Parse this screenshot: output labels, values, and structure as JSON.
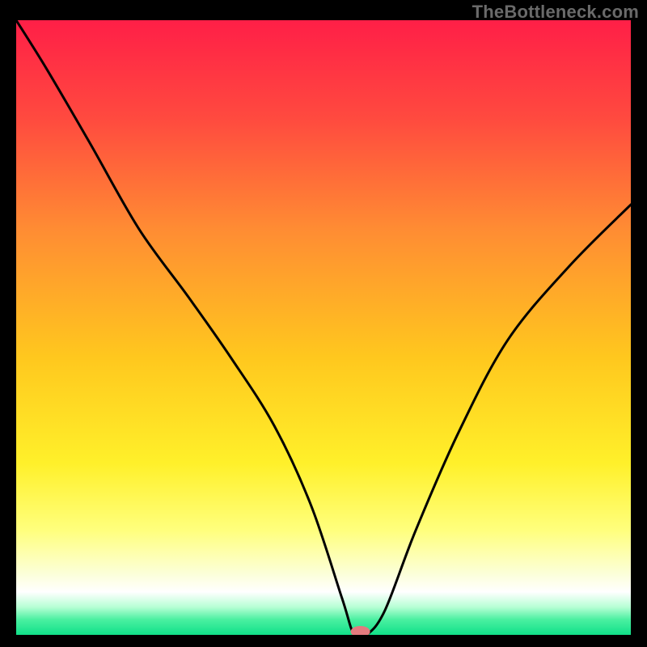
{
  "watermark": "TheBottleneck.com",
  "chart_data": {
    "type": "line",
    "title": "",
    "xlabel": "",
    "ylabel": "",
    "xlim": [
      0,
      100
    ],
    "ylim": [
      0,
      100
    ],
    "x": [
      0,
      5,
      12,
      20,
      28,
      35,
      42,
      48,
      53,
      55,
      57,
      60,
      65,
      72,
      80,
      90,
      100
    ],
    "values": [
      100,
      92,
      80,
      66,
      55,
      45,
      34,
      21,
      6,
      0,
      0,
      4,
      17,
      33,
      48,
      60,
      70
    ],
    "marker": {
      "x": 56,
      "y": 0,
      "color": "#e37b7f",
      "rx": 6,
      "ry": 3.5
    },
    "gradient_stops": [
      {
        "offset": 0.0,
        "color": "#ff1f47"
      },
      {
        "offset": 0.16,
        "color": "#ff4a3f"
      },
      {
        "offset": 0.34,
        "color": "#ff8c33"
      },
      {
        "offset": 0.55,
        "color": "#ffc81e"
      },
      {
        "offset": 0.72,
        "color": "#fff02a"
      },
      {
        "offset": 0.83,
        "color": "#ffff7d"
      },
      {
        "offset": 0.9,
        "color": "#fcffd8"
      },
      {
        "offset": 0.93,
        "color": "#ffffff"
      },
      {
        "offset": 0.955,
        "color": "#b6ffd4"
      },
      {
        "offset": 0.975,
        "color": "#4bf0a1"
      },
      {
        "offset": 1.0,
        "color": "#10e089"
      }
    ]
  }
}
